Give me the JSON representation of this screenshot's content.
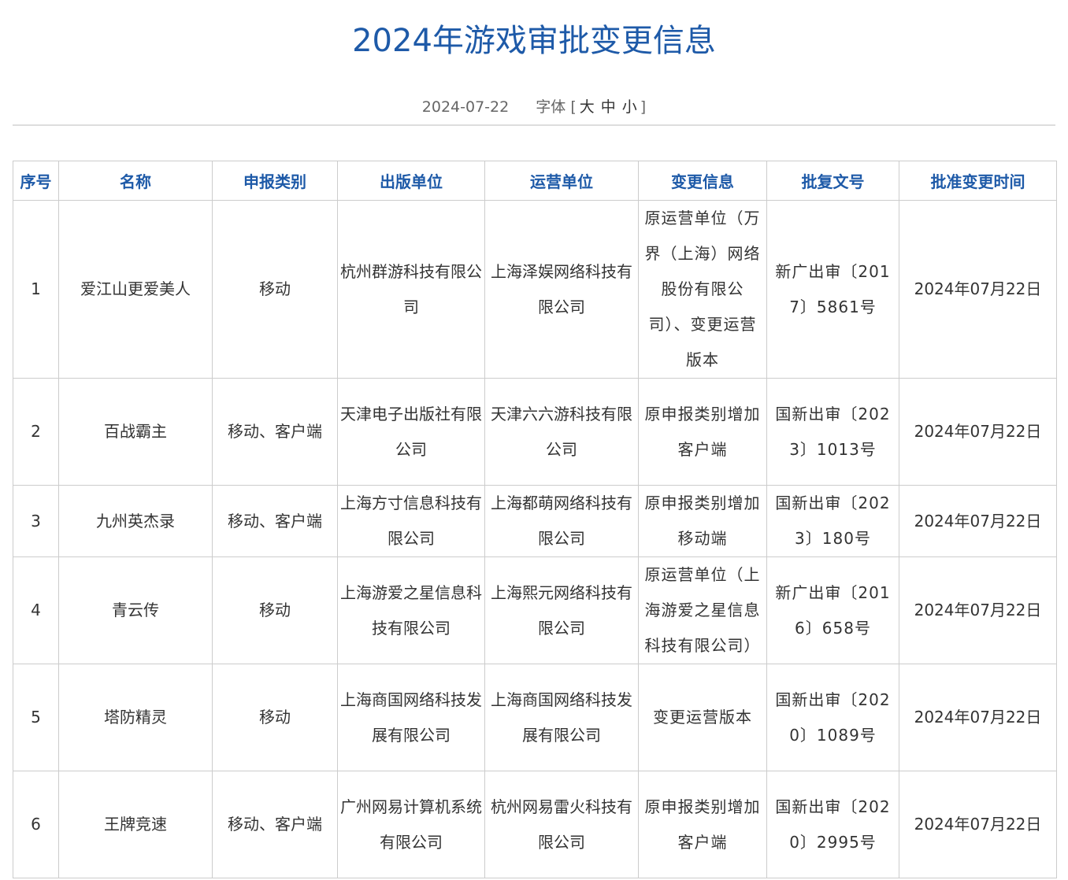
{
  "header": {
    "title": "2024年游戏审批变更信息",
    "date": "2024-07-22",
    "font_label": "字体",
    "bracket_open": "[",
    "bracket_close": "]",
    "font_sizes": [
      "大",
      "中",
      "小"
    ]
  },
  "table": {
    "columns": [
      "序号",
      "名称",
      "申报类别",
      "出版单位",
      "运营单位",
      "变更信息",
      "批复文号",
      "批准变更时间"
    ],
    "rows": [
      {
        "no": "1",
        "name": "爱江山更爱美人",
        "category": "移动",
        "publisher": "杭州群游科技有限公司",
        "operator": "上海泽娱网络科技有限公司",
        "change": "原运营单位（万界（上海）网络股份有限公司）、变更运营版本",
        "approval": "新广出审〔2017〕5861号",
        "time": "2024年07月22日"
      },
      {
        "no": "2",
        "name": "百战霸主",
        "category": "移动、客户端",
        "publisher": "天津电子出版社有限公司",
        "operator": "天津六六游科技有限公司",
        "change": "原申报类别增加客户端",
        "approval": "国新出审〔2023〕1013号",
        "time": "2024年07月22日"
      },
      {
        "no": "3",
        "name": "九州英杰录",
        "category": "移动、客户端",
        "publisher": "上海方寸信息科技有限公司",
        "operator": "上海都萌网络科技有限公司",
        "change": "原申报类别增加移动端",
        "approval": "国新出审〔2023〕180号",
        "time": "2024年07月22日"
      },
      {
        "no": "4",
        "name": "青云传",
        "category": "移动",
        "publisher": "上海游爱之星信息科技有限公司",
        "operator": "上海熙元网络科技有限公司",
        "change": "原运营单位（上海游爱之星信息科技有限公司）",
        "approval": "新广出审〔2016〕658号",
        "time": "2024年07月22日"
      },
      {
        "no": "5",
        "name": "塔防精灵",
        "category": "移动",
        "publisher": "上海商国网络科技发展有限公司",
        "operator": "上海商国网络科技发展有限公司",
        "change": "变更运营版本",
        "approval": "国新出审〔2020〕1089号",
        "time": "2024年07月22日"
      },
      {
        "no": "6",
        "name": "王牌竞速",
        "category": "移动、客户端",
        "publisher": "广州网易计算机系统有限公司",
        "operator": "杭州网易雷火科技有限公司",
        "change": "原申报类别增加客户端",
        "approval": "国新出审〔2020〕2995号",
        "time": "2024年07月22日"
      }
    ]
  }
}
